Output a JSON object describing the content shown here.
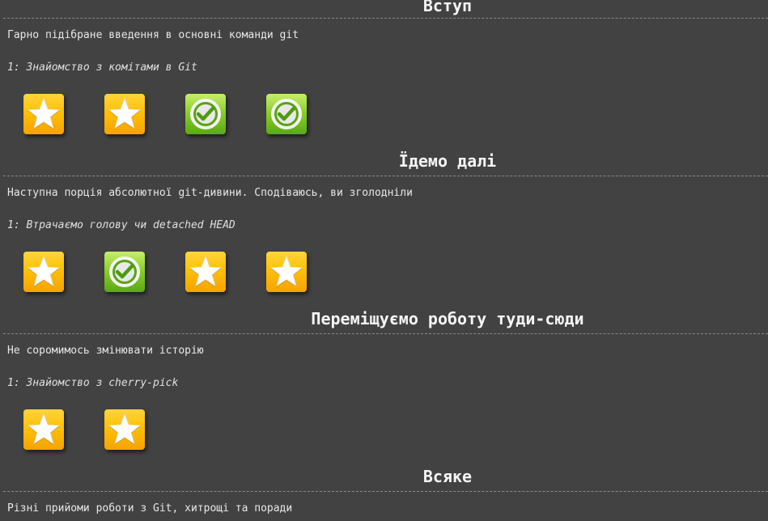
{
  "sequences": [
    {
      "title": "Вступ",
      "about": "Гарно підібране введення в основні команди git",
      "selected_level_label": "1: Знайомство з комітами в Git",
      "levels": [
        {
          "state": "unsolved",
          "icon": "star-icon"
        },
        {
          "state": "unsolved",
          "icon": "star-icon"
        },
        {
          "state": "solved",
          "icon": "checkmark-icon"
        },
        {
          "state": "solved",
          "icon": "checkmark-icon"
        }
      ]
    },
    {
      "title": "Їдемо далі",
      "about": "Наступна порція абсолютної git-дивини. Сподіваюсь, ви зголодніли",
      "selected_level_label": "1: Втрачаємо голову чи detached HEAD",
      "levels": [
        {
          "state": "unsolved",
          "icon": "star-icon"
        },
        {
          "state": "solved",
          "icon": "checkmark-icon"
        },
        {
          "state": "unsolved",
          "icon": "star-icon"
        },
        {
          "state": "unsolved",
          "icon": "star-icon"
        }
      ]
    },
    {
      "title": "Переміщуємо роботу туди-сюди",
      "about": "Не соромимось змінювати історію",
      "selected_level_label": "1: Знайомство з cherry-pick",
      "levels": [
        {
          "state": "unsolved",
          "icon": "star-icon"
        },
        {
          "state": "unsolved",
          "icon": "star-icon"
        }
      ]
    },
    {
      "title": "Всяке",
      "about": "Різні прийоми роботи з Git, хитрощі та поради"
    }
  ],
  "colors": {
    "background": "#424242",
    "star_tile": "#ffc107",
    "solved_tile": "#7cc31f"
  }
}
